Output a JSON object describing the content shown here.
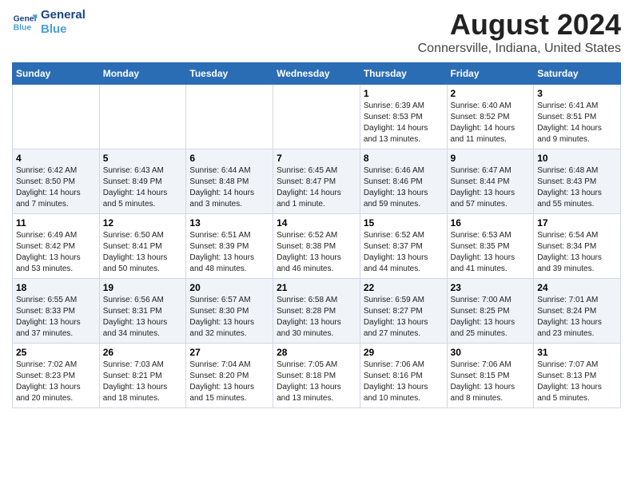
{
  "logo": {
    "line1": "General",
    "line2": "Blue"
  },
  "title": "August 2024",
  "subtitle": "Connersville, Indiana, United States",
  "days_of_week": [
    "Sunday",
    "Monday",
    "Tuesday",
    "Wednesday",
    "Thursday",
    "Friday",
    "Saturday"
  ],
  "weeks": [
    [
      {
        "day": "",
        "info": ""
      },
      {
        "day": "",
        "info": ""
      },
      {
        "day": "",
        "info": ""
      },
      {
        "day": "",
        "info": ""
      },
      {
        "day": "1",
        "info": "Sunrise: 6:39 AM\nSunset: 8:53 PM\nDaylight: 14 hours and 13 minutes."
      },
      {
        "day": "2",
        "info": "Sunrise: 6:40 AM\nSunset: 8:52 PM\nDaylight: 14 hours and 11 minutes."
      },
      {
        "day": "3",
        "info": "Sunrise: 6:41 AM\nSunset: 8:51 PM\nDaylight: 14 hours and 9 minutes."
      }
    ],
    [
      {
        "day": "4",
        "info": "Sunrise: 6:42 AM\nSunset: 8:50 PM\nDaylight: 14 hours and 7 minutes."
      },
      {
        "day": "5",
        "info": "Sunrise: 6:43 AM\nSunset: 8:49 PM\nDaylight: 14 hours and 5 minutes."
      },
      {
        "day": "6",
        "info": "Sunrise: 6:44 AM\nSunset: 8:48 PM\nDaylight: 14 hours and 3 minutes."
      },
      {
        "day": "7",
        "info": "Sunrise: 6:45 AM\nSunset: 8:47 PM\nDaylight: 14 hours and 1 minute."
      },
      {
        "day": "8",
        "info": "Sunrise: 6:46 AM\nSunset: 8:46 PM\nDaylight: 13 hours and 59 minutes."
      },
      {
        "day": "9",
        "info": "Sunrise: 6:47 AM\nSunset: 8:44 PM\nDaylight: 13 hours and 57 minutes."
      },
      {
        "day": "10",
        "info": "Sunrise: 6:48 AM\nSunset: 8:43 PM\nDaylight: 13 hours and 55 minutes."
      }
    ],
    [
      {
        "day": "11",
        "info": "Sunrise: 6:49 AM\nSunset: 8:42 PM\nDaylight: 13 hours and 53 minutes."
      },
      {
        "day": "12",
        "info": "Sunrise: 6:50 AM\nSunset: 8:41 PM\nDaylight: 13 hours and 50 minutes."
      },
      {
        "day": "13",
        "info": "Sunrise: 6:51 AM\nSunset: 8:39 PM\nDaylight: 13 hours and 48 minutes."
      },
      {
        "day": "14",
        "info": "Sunrise: 6:52 AM\nSunset: 8:38 PM\nDaylight: 13 hours and 46 minutes."
      },
      {
        "day": "15",
        "info": "Sunrise: 6:52 AM\nSunset: 8:37 PM\nDaylight: 13 hours and 44 minutes."
      },
      {
        "day": "16",
        "info": "Sunrise: 6:53 AM\nSunset: 8:35 PM\nDaylight: 13 hours and 41 minutes."
      },
      {
        "day": "17",
        "info": "Sunrise: 6:54 AM\nSunset: 8:34 PM\nDaylight: 13 hours and 39 minutes."
      }
    ],
    [
      {
        "day": "18",
        "info": "Sunrise: 6:55 AM\nSunset: 8:33 PM\nDaylight: 13 hours and 37 minutes."
      },
      {
        "day": "19",
        "info": "Sunrise: 6:56 AM\nSunset: 8:31 PM\nDaylight: 13 hours and 34 minutes."
      },
      {
        "day": "20",
        "info": "Sunrise: 6:57 AM\nSunset: 8:30 PM\nDaylight: 13 hours and 32 minutes."
      },
      {
        "day": "21",
        "info": "Sunrise: 6:58 AM\nSunset: 8:28 PM\nDaylight: 13 hours and 30 minutes."
      },
      {
        "day": "22",
        "info": "Sunrise: 6:59 AM\nSunset: 8:27 PM\nDaylight: 13 hours and 27 minutes."
      },
      {
        "day": "23",
        "info": "Sunrise: 7:00 AM\nSunset: 8:25 PM\nDaylight: 13 hours and 25 minutes."
      },
      {
        "day": "24",
        "info": "Sunrise: 7:01 AM\nSunset: 8:24 PM\nDaylight: 13 hours and 23 minutes."
      }
    ],
    [
      {
        "day": "25",
        "info": "Sunrise: 7:02 AM\nSunset: 8:23 PM\nDaylight: 13 hours and 20 minutes."
      },
      {
        "day": "26",
        "info": "Sunrise: 7:03 AM\nSunset: 8:21 PM\nDaylight: 13 hours and 18 minutes."
      },
      {
        "day": "27",
        "info": "Sunrise: 7:04 AM\nSunset: 8:20 PM\nDaylight: 13 hours and 15 minutes."
      },
      {
        "day": "28",
        "info": "Sunrise: 7:05 AM\nSunset: 8:18 PM\nDaylight: 13 hours and 13 minutes."
      },
      {
        "day": "29",
        "info": "Sunrise: 7:06 AM\nSunset: 8:16 PM\nDaylight: 13 hours and 10 minutes."
      },
      {
        "day": "30",
        "info": "Sunrise: 7:06 AM\nSunset: 8:15 PM\nDaylight: 13 hours and 8 minutes."
      },
      {
        "day": "31",
        "info": "Sunrise: 7:07 AM\nSunset: 8:13 PM\nDaylight: 13 hours and 5 minutes."
      }
    ]
  ]
}
